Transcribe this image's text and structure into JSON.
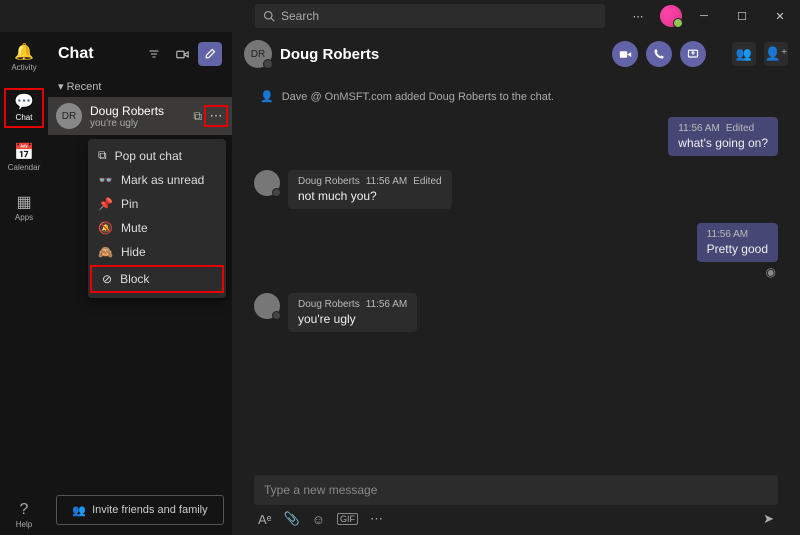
{
  "search": {
    "placeholder": "Search"
  },
  "rail": {
    "items": [
      {
        "label": "Activity"
      },
      {
        "label": "Chat"
      },
      {
        "label": "Calendar"
      },
      {
        "label": "Apps"
      }
    ],
    "help_label": "Help"
  },
  "sidebar": {
    "title": "Chat",
    "recent_label": "Recent",
    "chat": {
      "initials": "DR",
      "name": "Doug Roberts",
      "preview": "you're ugly"
    },
    "context_menu": {
      "popout": "Pop out chat",
      "unread": "Mark as unread",
      "pin": "Pin",
      "mute": "Mute",
      "hide": "Hide",
      "block": "Block"
    },
    "invite_label": "Invite friends and family"
  },
  "chat_header": {
    "name": "Doug Roberts"
  },
  "system_msg": "Dave @ OnMSFT.com added Doug Roberts to the chat.",
  "messages": {
    "m1": {
      "time": "11:56 AM",
      "edited": "Edited",
      "body": "what's going on?"
    },
    "m2": {
      "name": "Doug Roberts",
      "time": "11:56 AM",
      "edited": "Edited",
      "body": "not much you?"
    },
    "m3": {
      "time": "11:56 AM",
      "body": "Pretty good"
    },
    "m4": {
      "name": "Doug Roberts",
      "time": "11:56 AM",
      "body": "you're ugly"
    }
  },
  "compose": {
    "placeholder": "Type a new message",
    "gif_label": "GIF"
  }
}
